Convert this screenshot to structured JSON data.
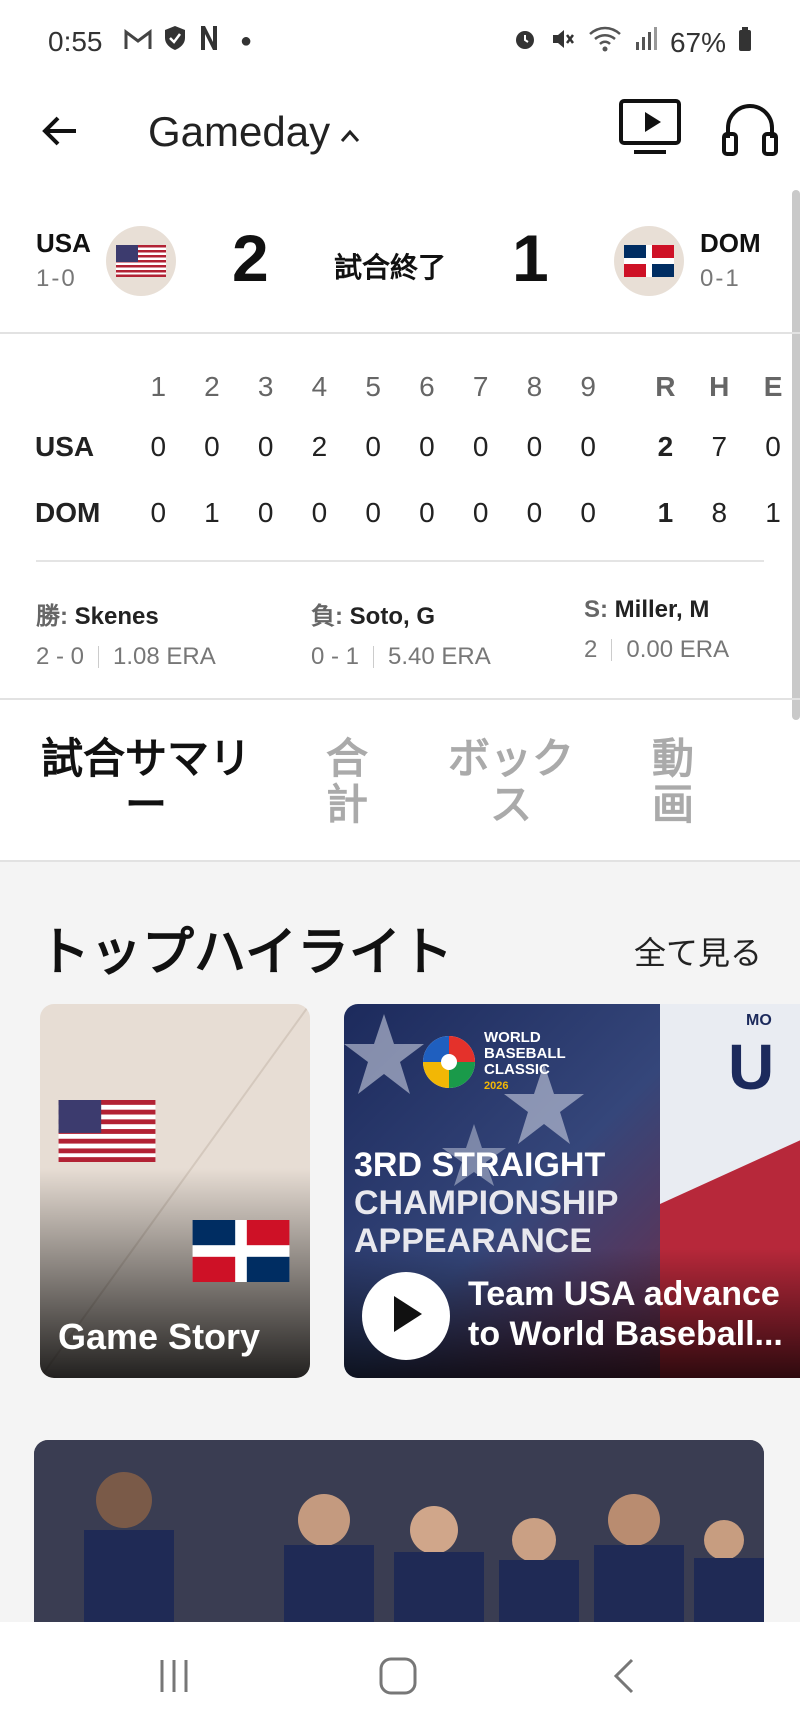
{
  "status_bar": {
    "time": "0:55",
    "battery": "67%",
    "left_icons": [
      "gmail-icon",
      "shield-icon",
      "n-icon",
      "dot-icon"
    ],
    "right_icons": [
      "alarm-icon",
      "mute-icon",
      "wifi-icon",
      "signal-icon",
      "battery-icon"
    ]
  },
  "app_bar": {
    "title": "Gameday",
    "title_caret": "^"
  },
  "game": {
    "away": {
      "abbr": "USA",
      "record": "1-0",
      "score": "2"
    },
    "home": {
      "abbr": "DOM",
      "record": "0-1",
      "score": "1"
    },
    "state": "試合終了"
  },
  "linescore": {
    "innings": [
      "1",
      "2",
      "3",
      "4",
      "5",
      "6",
      "7",
      "8",
      "9"
    ],
    "totals_headers": [
      "R",
      "H",
      "E"
    ],
    "rows": [
      {
        "team": "USA",
        "innings": [
          "0",
          "0",
          "0",
          "2",
          "0",
          "0",
          "0",
          "0",
          "0"
        ],
        "totals": [
          "2",
          "7",
          "0"
        ]
      },
      {
        "team": "DOM",
        "innings": [
          "0",
          "1",
          "0",
          "0",
          "0",
          "0",
          "0",
          "0",
          "0"
        ],
        "totals": [
          "1",
          "8",
          "1"
        ]
      }
    ]
  },
  "pitchers": [
    {
      "label": "勝:",
      "name": "Skenes",
      "record": "2 - 0",
      "era": "1.08 ERA"
    },
    {
      "label": "負:",
      "name": "Soto, G",
      "record": "0 - 1",
      "era": "5.40 ERA"
    },
    {
      "label": "S:",
      "name": "Miller, M",
      "record": "2",
      "era": "0.00 ERA"
    }
  ],
  "tabs": [
    {
      "label": "試合サマリー",
      "active": true
    },
    {
      "label": "合計",
      "active": false
    },
    {
      "label": "ボックス",
      "active": false
    },
    {
      "label": "動画",
      "active": false
    }
  ],
  "highlights": {
    "title": "トップハイライト",
    "see_all": "全て見る",
    "cards": [
      {
        "label": "Game Story"
      },
      {
        "logo_text": [
          "WORLD",
          "BASEBALL",
          "CLASSIC",
          "2026"
        ],
        "headline_lines": [
          "3RD STRAIGHT",
          "CHAMPIONSHIP",
          "APPEARANCE"
        ],
        "title_lines": [
          "Team USA advance",
          "to World Baseball..."
        ],
        "side_text": [
          "MO",
          "U"
        ]
      }
    ]
  },
  "colors": {
    "usa_red": "#b22234",
    "usa_blue": "#3c3b6e",
    "dom_red": "#ce1126",
    "dom_blue": "#002d62"
  }
}
